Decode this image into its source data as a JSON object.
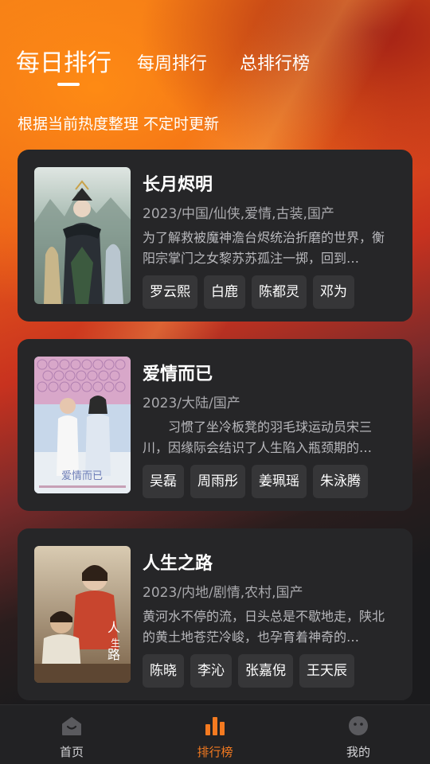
{
  "tabs": [
    {
      "label": "每日排行",
      "active": true
    },
    {
      "label": "每周排行",
      "active": false
    },
    {
      "label": "总排行榜",
      "active": false
    }
  ],
  "subtitle": "根据当前热度整理 不定时更新",
  "shows": [
    {
      "title": "长月烬明",
      "meta": "2023/中国/仙侠,爱情,古装,国产",
      "description": "为了解救被魔神澹台烬统治折磨的世界，衡阳宗掌门之女黎苏苏孤注一掷，回到…",
      "cast": [
        "罗云熙",
        "白鹿",
        "陈都灵",
        "邓为"
      ]
    },
    {
      "title": "爱情而已",
      "meta": "2023/大陆/国产",
      "description": "　　习惯了坐冷板凳的羽毛球运动员宋三川，因缘际会结识了人生陷入瓶颈期的…",
      "cast": [
        "吴磊",
        "周雨彤",
        "姜珮瑶",
        "朱泳腾"
      ]
    },
    {
      "title": "人生之路",
      "meta": "2023/内地/剧情,农村,国产",
      "description": "黄河水不停的流，日头总是不歇地走，陕北的黄土地苍茫冷峻，也孕育着神奇的…",
      "cast": [
        "陈晓",
        "李沁",
        "张嘉倪",
        "王天辰"
      ]
    }
  ],
  "nav": [
    {
      "label": "首页",
      "icon": "home-icon",
      "active": false
    },
    {
      "label": "排行榜",
      "icon": "ranking-icon",
      "active": true
    },
    {
      "label": "我的",
      "icon": "profile-icon",
      "active": false
    }
  ],
  "colors": {
    "accent": "#f47a20",
    "card_bg": "#262628",
    "chip_bg": "#363638"
  }
}
